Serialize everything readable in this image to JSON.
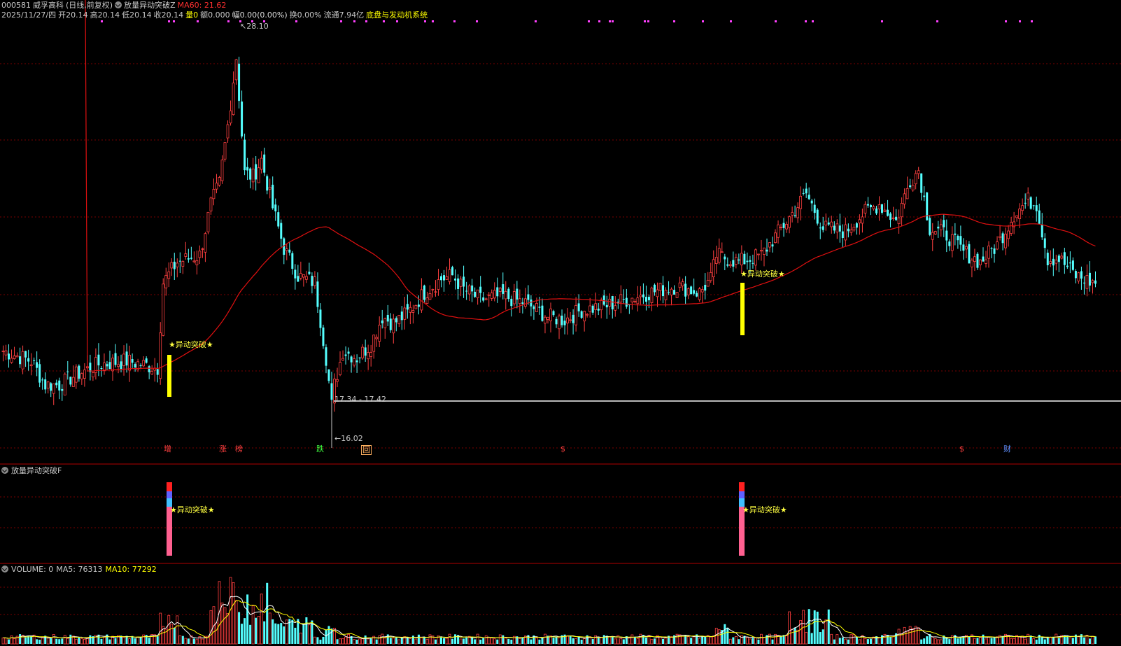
{
  "header": {
    "code": "000581",
    "name": "威孚高科",
    "period": "(日线,前复权)",
    "indicator_main": "放量异动突破Z",
    "ma60_label": "MA60: 21.62",
    "date": "2025/11/27/四",
    "open": "开20.14",
    "high": "高20.14",
    "low": "低20.14",
    "close": "收20.14",
    "vol": "量0",
    "amount": "额0.000",
    "change": "幅0.00(0.00%)",
    "turnover": "换0.00%",
    "float": "流通7.94亿",
    "system": "底盘与发动机系统"
  },
  "annotations": {
    "high_price": "28.10",
    "low_price": "16.02",
    "range_label": "17.34 - 17.42",
    "signal_text": "★异动突破★",
    "event_markers": [
      {
        "text": "增",
        "color": "#ff4040"
      },
      {
        "text": "涨",
        "color": "#ff4040"
      },
      {
        "text": "榜",
        "color": "#ff4040"
      },
      {
        "text": "跌",
        "color": "#40ff40"
      },
      {
        "text": "回",
        "color": "#ffb060"
      },
      {
        "text": "$",
        "color": "#ff4040"
      },
      {
        "text": "$",
        "color": "#ff4040"
      },
      {
        "text": "财",
        "color": "#6090ff"
      }
    ]
  },
  "panel2": {
    "title": "放量异动突破F",
    "signal_text": "★异动突破★"
  },
  "volume_panel": {
    "label": "VOLUME: 0",
    "ma5": "MA5: 76313",
    "ma10": "MA10: 77292"
  },
  "colors": {
    "up": "#ff4040",
    "down": "#54ffff",
    "ma60": "#e01010",
    "grid": "#7a0000",
    "signal": "#ffff00"
  },
  "chart_data": {
    "type": "candlestick",
    "ma60_last": 21.62,
    "high": 28.1,
    "low": 16.02,
    "signal_indices": [
      56,
      254
    ]
  }
}
